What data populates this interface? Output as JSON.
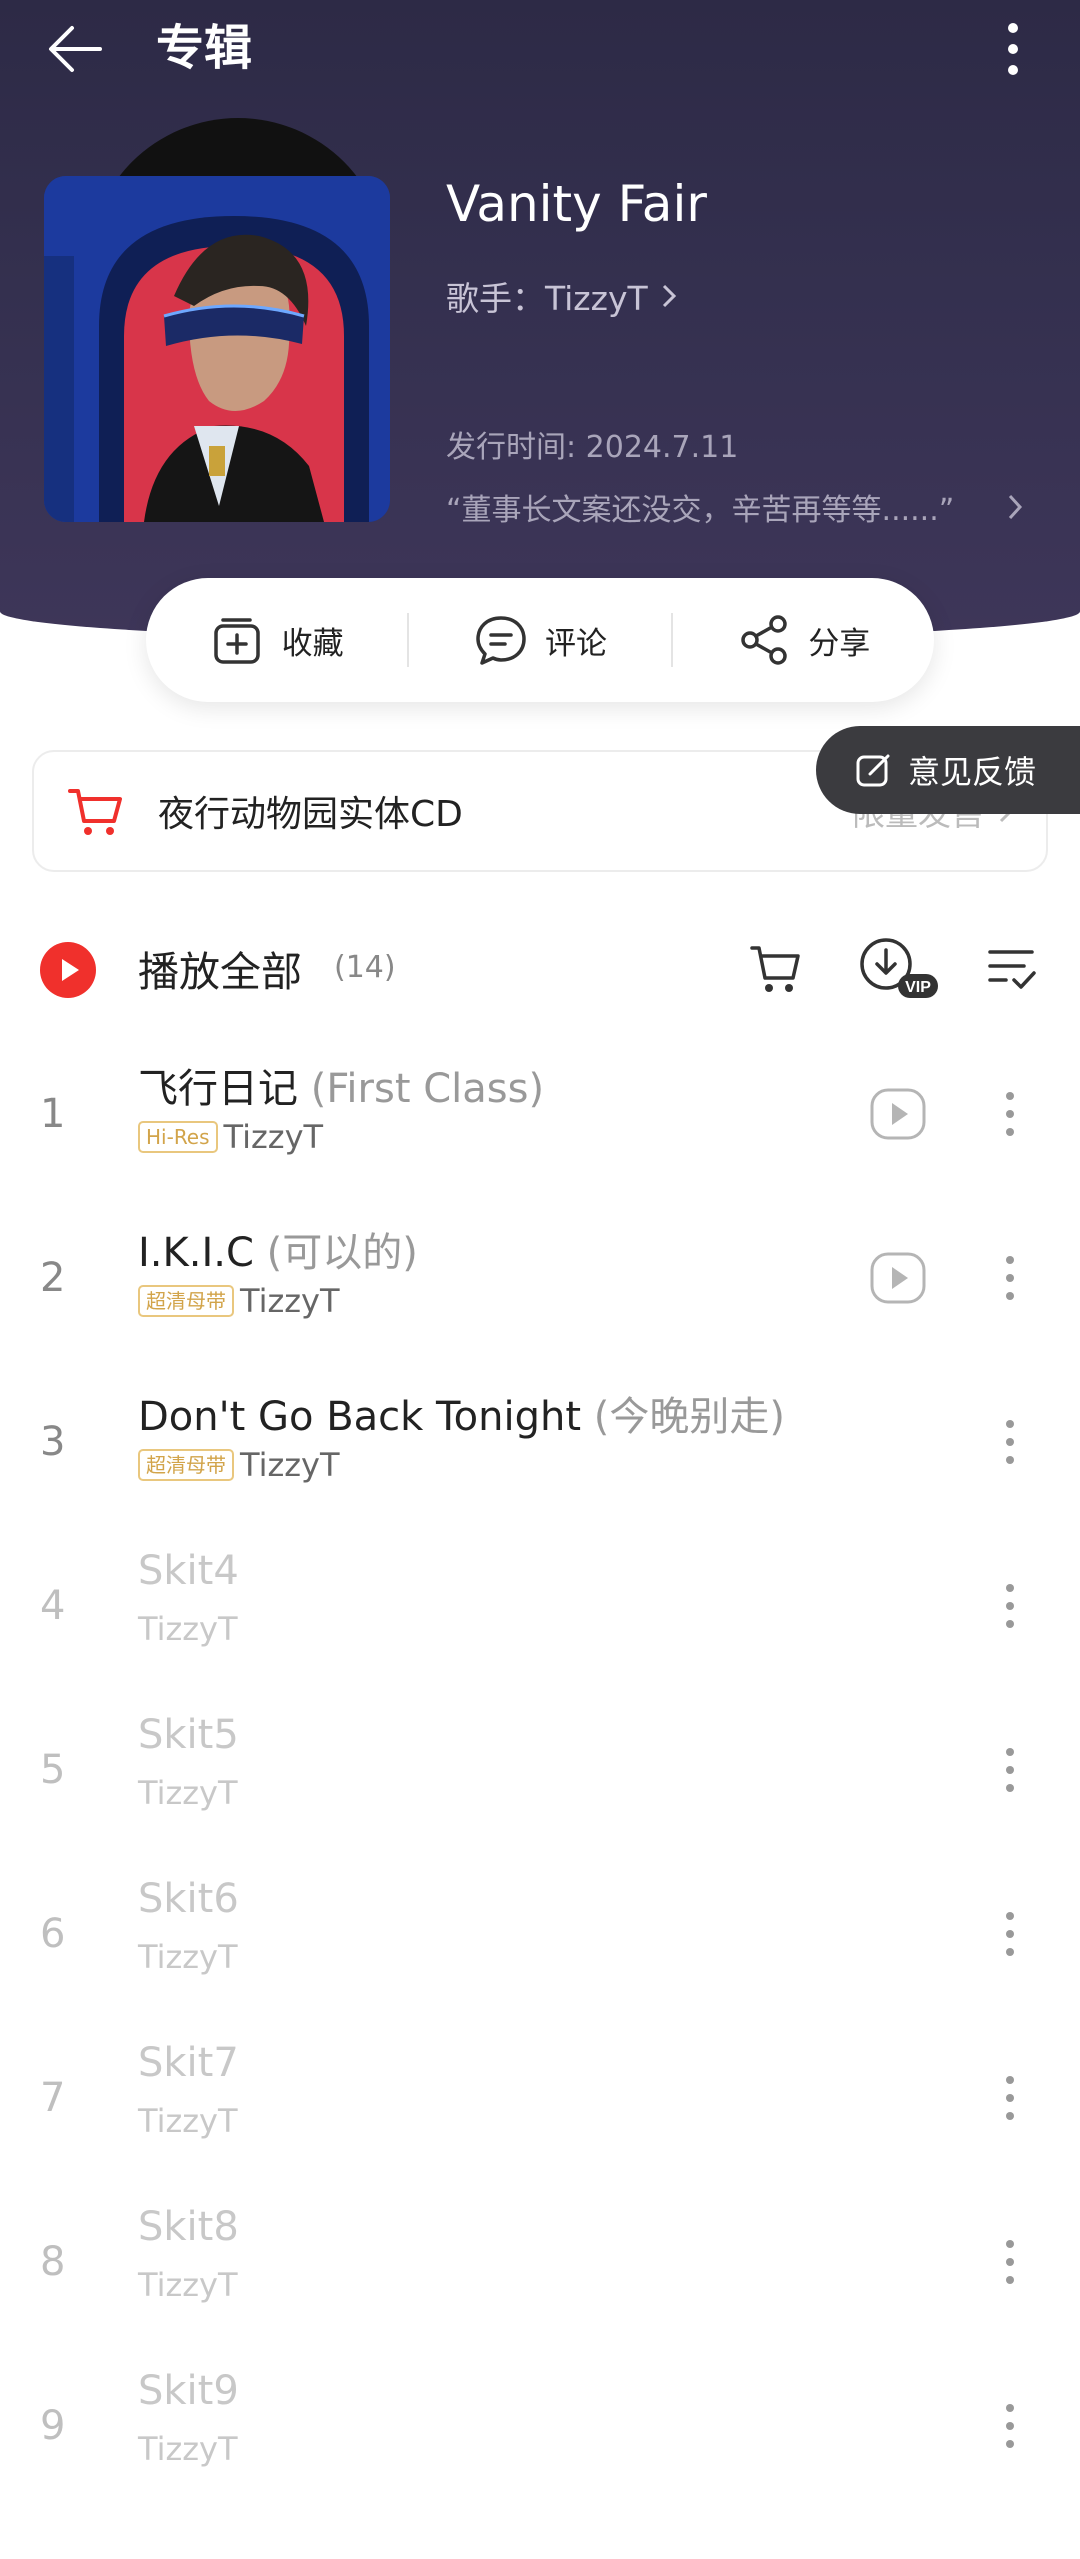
{
  "header": {
    "title": "专辑"
  },
  "album": {
    "name": "Vanity Fair",
    "singer": "歌手：TizzyT",
    "release": "发行时间: 2024.7.11",
    "description": "“董事长文案还没交，辛苦再等等......”"
  },
  "actions": {
    "collect": "收藏",
    "comment": "评论",
    "share": "分享"
  },
  "cd_banner": {
    "label": "夜行动物园实体CD",
    "right_text": "限量发售"
  },
  "feedback": {
    "label": "意见反馈"
  },
  "play_all": {
    "label": "播放全部",
    "count": "(14)"
  },
  "tracks": [
    {
      "num": "1",
      "title": "飞行日记",
      "sub": "(First Class)",
      "badge": "Hi-Res",
      "artist": "TizzyT",
      "mv": true,
      "available": true
    },
    {
      "num": "2",
      "title": "I.K.I.C",
      "sub": "(可以的)",
      "badge": "超清母带",
      "artist": "TizzyT",
      "mv": true,
      "available": true
    },
    {
      "num": "3",
      "title": "Don't Go Back Tonight",
      "sub": "(今晚别走)",
      "badge": "超清母带",
      "artist": "TizzyT",
      "mv": false,
      "available": true
    },
    {
      "num": "4",
      "title": "Skit4",
      "sub": "",
      "badge": "",
      "artist": "TizzyT",
      "mv": false,
      "available": false
    },
    {
      "num": "5",
      "title": "Skit5",
      "sub": "",
      "badge": "",
      "artist": "TizzyT",
      "mv": false,
      "available": false
    },
    {
      "num": "6",
      "title": "Skit6",
      "sub": "",
      "badge": "",
      "artist": "TizzyT",
      "mv": false,
      "available": false
    },
    {
      "num": "7",
      "title": "Skit7",
      "sub": "",
      "badge": "",
      "artist": "TizzyT",
      "mv": false,
      "available": false
    },
    {
      "num": "8",
      "title": "Skit8",
      "sub": "",
      "badge": "",
      "artist": "TizzyT",
      "mv": false,
      "available": false
    },
    {
      "num": "9",
      "title": "Skit9",
      "sub": "",
      "badge": "",
      "artist": "TizzyT",
      "mv": false,
      "available": false
    }
  ],
  "colors": {
    "hero_bg": "#2d2a46",
    "accent_red": "#f0302c",
    "badge_gold": "#d2a44a"
  },
  "icons": {
    "back": "arrow-left-icon",
    "more": "more-vertical-icon",
    "collect": "add-collection-icon",
    "comment": "comment-bubble-icon",
    "share": "share-icon",
    "cart": "shopping-cart-icon",
    "feedback": "edit-icon",
    "play": "play-circle-icon",
    "download": "download-vip-icon",
    "multiselect": "list-check-icon",
    "mv": "play-video-icon"
  }
}
